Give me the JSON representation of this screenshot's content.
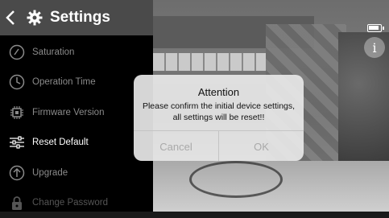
{
  "header": {
    "title": "Settings",
    "back_icon": "chevron-left-icon",
    "gear_icon": "gear-icon"
  },
  "menu": {
    "items": [
      {
        "label": "Saturation",
        "icon": "saturation-icon"
      },
      {
        "label": "Operation Time",
        "icon": "clock-icon"
      },
      {
        "label": "Firmware Version",
        "icon": "chip-icon"
      },
      {
        "label": "Reset Default",
        "icon": "sliders-icon",
        "active": true
      },
      {
        "label": "Upgrade",
        "icon": "upload-arrow-icon"
      },
      {
        "label": "Change Password",
        "icon": "lock-icon"
      }
    ]
  },
  "dialog": {
    "title": "Attention",
    "message": "Please confirm the initial device settings, all settings will be reset!!",
    "cancel": "Cancel",
    "ok": "OK"
  },
  "status": {
    "battery_icon": "battery-icon",
    "info_icon": "info-icon",
    "info_glyph": "i"
  },
  "colors": {
    "panel": "#000000",
    "header": "#4a4a4a",
    "active_text": "#ffffff",
    "inactive_text": "#8a8a8a"
  }
}
